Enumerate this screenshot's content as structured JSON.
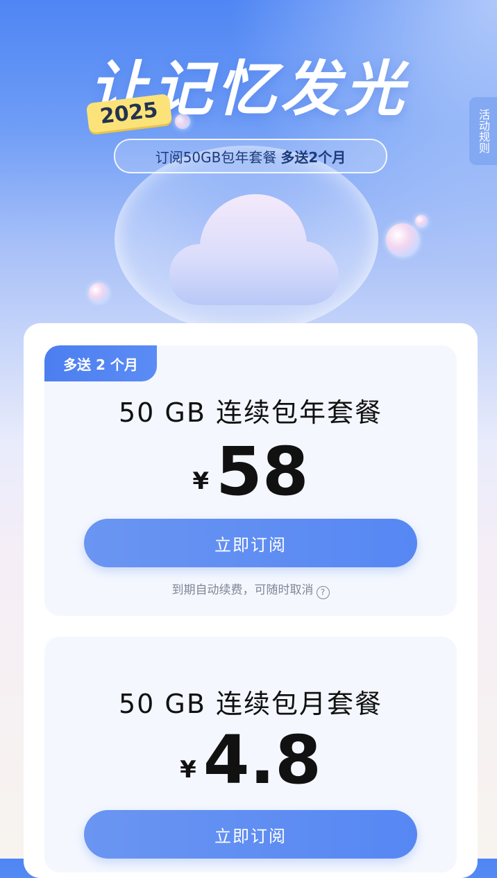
{
  "hero": {
    "title": "让记忆发光",
    "year_badge": "2025",
    "promo_text": "订阅50GB包年套餐",
    "promo_bonus": "多送2个月"
  },
  "rules_tab": {
    "label": "活动规则"
  },
  "plans": [
    {
      "ribbon": "多送 2 个月",
      "name": "50 GB 连续包年套餐",
      "currency": "¥",
      "price": "58",
      "button": "立即订阅",
      "note": "到期自动续费，可随时取消"
    },
    {
      "name": "50 GB 连续包月套餐",
      "currency": "¥",
      "price": "4.8",
      "button": "立即订阅"
    }
  ],
  "icons": {
    "help": "question-circle-icon",
    "cloud": "cloud-icon"
  },
  "colors": {
    "accent_blue": "#5687f3",
    "ribbon_blue": "#4c7ef0",
    "badge_yellow": "#fbe37a",
    "card_bg": "#f4f7fe"
  }
}
